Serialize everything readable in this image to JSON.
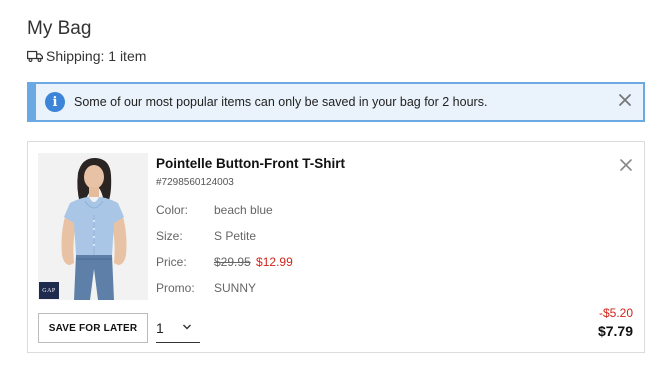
{
  "page": {
    "title": "My Bag",
    "shipping_label": "Shipping: 1 item"
  },
  "notice": {
    "icon": "info-icon",
    "message": "Some of our most popular items can only be saved in your bag for 2 hours.",
    "accent_color": "#6ba9e3"
  },
  "item": {
    "name": "Pointelle Button-Front T-Shirt",
    "sku": "#7298560124003",
    "brand_logo": "GAP",
    "attributes": {
      "color_label": "Color:",
      "color_value": "beach blue",
      "size_label": "Size:",
      "size_value": "S Petite",
      "price_label": "Price:",
      "price_original": "$29.95",
      "price_sale": "$12.99",
      "promo_label": "Promo:",
      "promo_value": "SUNNY"
    },
    "save_for_later_label": "SAVE FOR LATER",
    "quantity": "1",
    "discount": "-$5.20",
    "total": "$7.79",
    "sale_color": "#d0261b"
  }
}
